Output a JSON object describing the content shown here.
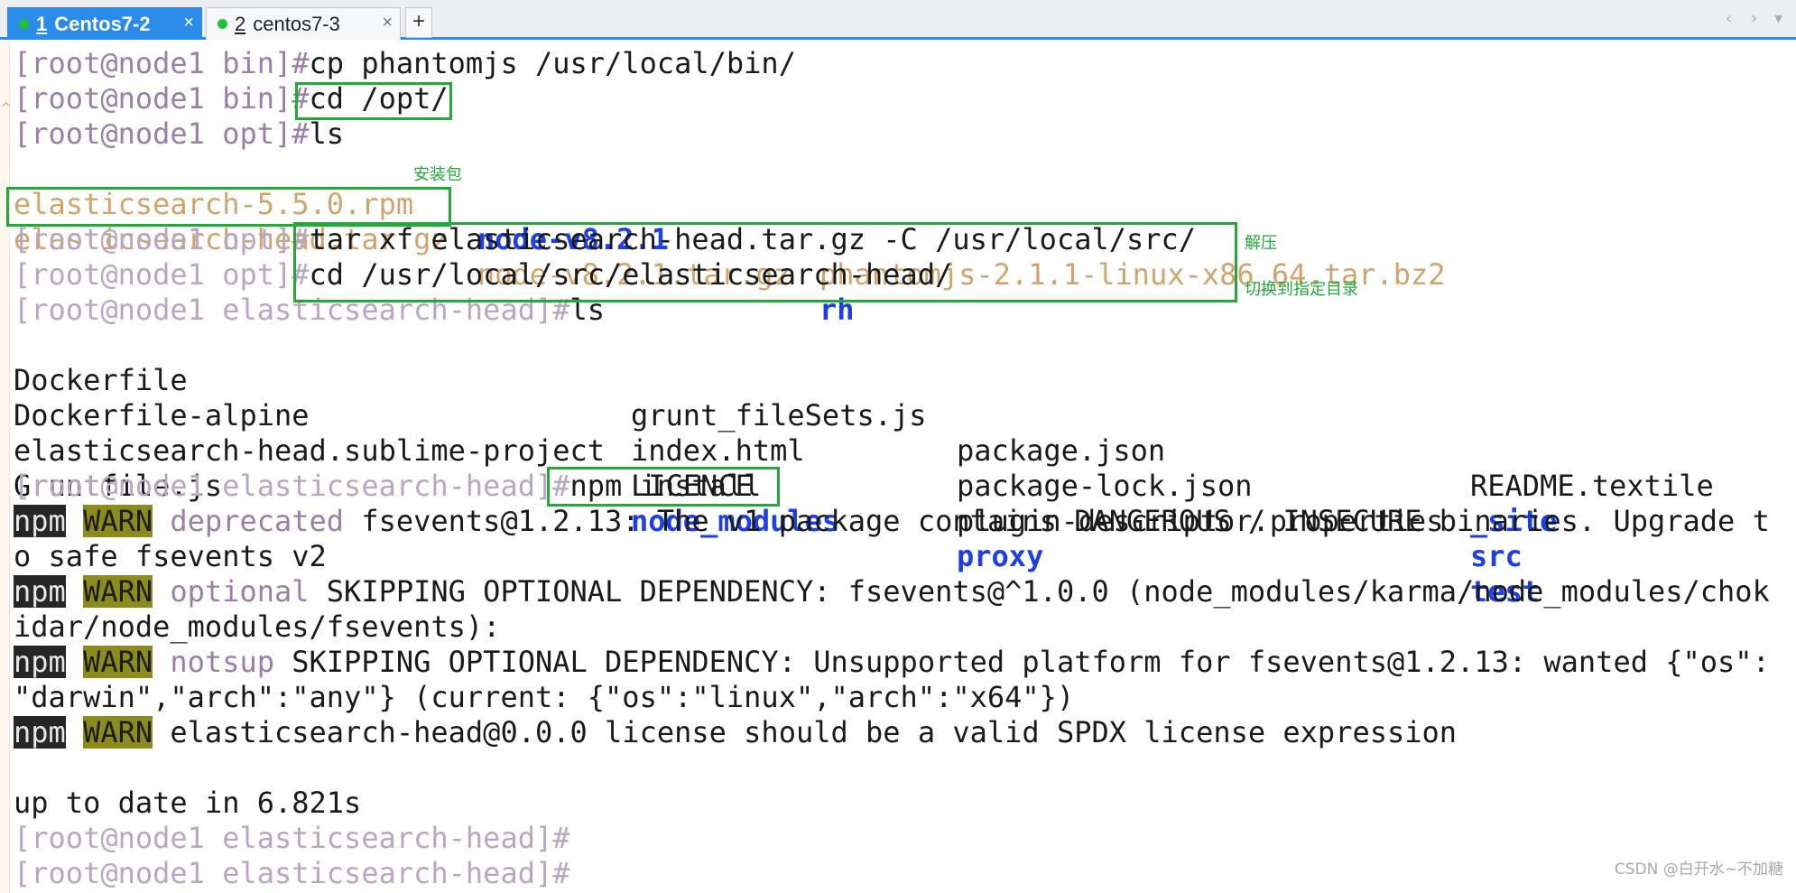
{
  "tabs": [
    {
      "num": "1",
      "label": "Centos7-2",
      "close": "×"
    },
    {
      "num": "2",
      "label": "centos7-3",
      "close": "×"
    }
  ],
  "new_tab": "+",
  "nav": {
    "left": "‹",
    "right": "›",
    "menu": "▾"
  },
  "terminal": {
    "cmd1": {
      "prompt": "[root@node1 bin]#",
      "cmd": "cp phantomjs /usr/local/bin/"
    },
    "cmd2": {
      "prompt": "[root@node1 bin]#",
      "cmd": "cd /opt/"
    },
    "cmd3": {
      "prompt": "[root@node1 opt]#",
      "cmd": "ls"
    },
    "ls_opt": {
      "row1": [
        "elasticsearch-5.5.0.rpm",
        "node-v8.2.1",
        "phantomjs-2.1.1-linux-x86_64.tar.bz2"
      ],
      "row2": [
        "elasticsearch-head.tar.gz",
        "node-v8.2.1.tar.gz",
        "rh"
      ]
    },
    "cmd4": {
      "prompt": "[root@node1 opt]#",
      "cmd": "tar xf elasticsearch-head.tar.gz -C /usr/local/src/"
    },
    "cmd5": {
      "prompt": "[root@node1 opt]#",
      "cmd": "cd /usr/local/src/elasticsearch-head/"
    },
    "cmd6": {
      "prompt": "[root@node1 elasticsearch-head]#",
      "cmd": "ls"
    },
    "ls_head": {
      "col1": [
        "Dockerfile",
        "Dockerfile-alpine",
        "elasticsearch-head.sublime-project",
        "Gruntfile.js"
      ],
      "col2": [
        "grunt_fileSets.js",
        "index.html",
        "LICENCE",
        "node_modules"
      ],
      "col3": [
        "package.json",
        "package-lock.json",
        "plugin-descriptor.properties",
        "proxy"
      ],
      "col4": [
        "README.textile",
        "_site",
        "src",
        "test"
      ]
    },
    "cmd7": {
      "prompt": "[root@node1 elasticsearch-head]#",
      "cmd": "npm install"
    },
    "npm_tag": "npm",
    "warn_tag": "WARN",
    "warn1": {
      "kind": "deprecated",
      "line1": " fsevents@1.2.13: The v1 package contains DANGEROUS / INSECURE binaries. Upgrade t",
      "line2": "o safe fsevents v2"
    },
    "warn2": {
      "kind": "optional",
      "line1": " SKIPPING OPTIONAL DEPENDENCY: fsevents@^1.0.0 (node_modules/karma/node_modules/chok",
      "line2": "idar/node_modules/fsevents):"
    },
    "warn3": {
      "kind": "notsup",
      "line1": " SKIPPING OPTIONAL DEPENDENCY: Unsupported platform for fsevents@1.2.13: wanted {\"os\":",
      "line2": "\"darwin\",\"arch\":\"any\"} (current: {\"os\":\"linux\",\"arch\":\"x64\"})"
    },
    "warn4": {
      "text": " elasticsearch-head@0.0.0 license should be a valid SPDX license expression"
    },
    "result": "up to date in 6.821s",
    "prompt_end1": "[root@node1 elasticsearch-head]#",
    "prompt_end2": "[root@node1 elasticsearch-head]#"
  },
  "annotations": {
    "install_pkg": "安装包",
    "extract": "解压",
    "switch_dir": "切换到指定目录"
  },
  "watermark": "CSDN @白开水~不加糖",
  "colors": {
    "accent": "#2b8be8",
    "annotation": "#22a93a",
    "prompt": "#9a7fa6",
    "directory": "#1e3ee6",
    "archive": "#d1a46e"
  }
}
